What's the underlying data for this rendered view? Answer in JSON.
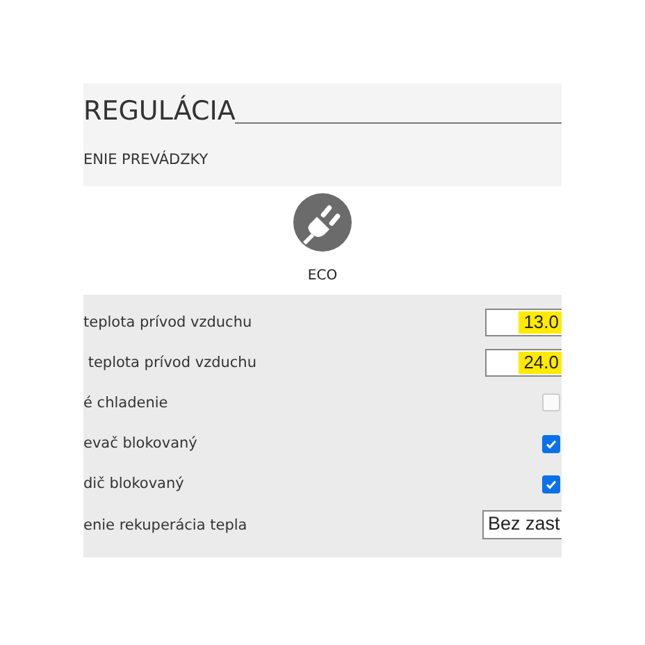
{
  "section": {
    "title": "REGULÁCIA",
    "subtitle": "ENIE PREVÁDZKY"
  },
  "mode": {
    "label": "ECO"
  },
  "settings": [
    {
      "kind": "number",
      "label": "teplota prívod vzduchu",
      "value": "13.0",
      "highlighted": true
    },
    {
      "kind": "number",
      "label": " teplota prívod vzduchu",
      "value": "24.0",
      "highlighted": true
    },
    {
      "kind": "checkbox",
      "label": "é chladenie",
      "checked": false
    },
    {
      "kind": "checkbox",
      "label": "evač blokovaný",
      "checked": true
    },
    {
      "kind": "checkbox",
      "label": "dič blokovaný",
      "checked": true
    },
    {
      "kind": "select",
      "label": "enie rekuperácia tepla",
      "value": "Bez zast"
    }
  ]
}
